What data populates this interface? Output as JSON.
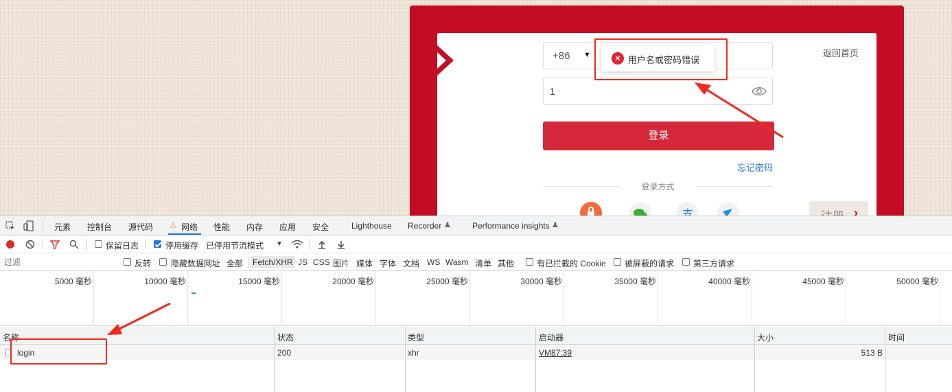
{
  "login_page": {
    "country_code": "+86",
    "password_value": "1",
    "login_button": "登录",
    "forgot_password": "忘记密码",
    "back_home": "返回首页",
    "login_methods_label": "登录方式",
    "register_button": "注册",
    "error_toast": "用户名或密码错误",
    "social_icons": [
      "lock-icon",
      "wechat-icon",
      "alipay-icon",
      "weibo-icon"
    ]
  },
  "devtools": {
    "tabs": [
      "元素",
      "控制台",
      "源代码",
      "网络",
      "性能",
      "内存",
      "应用",
      "安全",
      "Lighthouse",
      "Recorder",
      "Performance insights"
    ],
    "active_tab": "网络",
    "toolbar": {
      "preserve_log": "保留日志",
      "disable_cache": "停用缓存",
      "throttling": "已停用节流模式"
    },
    "filter": {
      "placeholder": "过滤",
      "invert": "反转",
      "hide_data_urls": "隐藏数据网址",
      "types": [
        "全部",
        "Fetch/XHR",
        "JS",
        "CSS",
        "图片",
        "媒体",
        "字体",
        "文档",
        "WS",
        "Wasm",
        "清单",
        "其他"
      ],
      "active_type": "Fetch/XHR",
      "blocked_cookies": "有已拦截的 Cookie",
      "blocked_requests": "被屏蔽的请求",
      "third_party": "第三方请求"
    },
    "timeline_ticks": [
      "5000 毫秒",
      "10000 毫秒",
      "15000 毫秒",
      "20000 毫秒",
      "25000 毫秒",
      "30000 毫秒",
      "35000 毫秒",
      "40000 毫秒",
      "45000 毫秒",
      "50000 毫秒"
    ],
    "columns": [
      "名称",
      "状态",
      "类型",
      "启动器",
      "大小",
      "时间"
    ],
    "requests": [
      {
        "name": "login",
        "status": "200",
        "type": "xhr",
        "initiator": "VM87:39",
        "size": "513 B",
        "time": ""
      }
    ]
  },
  "colors": {
    "brand_red": "#c40d24",
    "button_red": "#d5283a",
    "annotation_red": "#f02a1a",
    "link_blue": "#2a77d4",
    "devtools_accent": "#1a73e8"
  }
}
